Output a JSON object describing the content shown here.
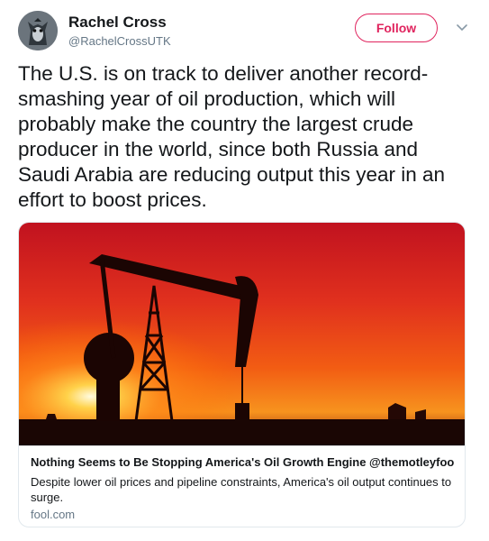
{
  "author": {
    "name": "Rachel Cross",
    "handle": "@RachelCrossUTK"
  },
  "actions": {
    "follow_label": "Follow",
    "more_icon": "chevron-down-icon"
  },
  "tweet": {
    "text": "The U.S. is on track to deliver another record-smashing year of oil production, which will probably make the country the largest crude producer in the world, since both Russia and Saudi Arabia are reducing output this year in an effort to boost prices."
  },
  "card": {
    "title": "Nothing Seems to Be Stopping America's Oil Growth Engine @themotleyfool ...",
    "description": "Despite lower oil prices and pipeline constraints, America's oil output continues to surge.",
    "domain": "fool.com"
  },
  "colors": {
    "follow_accent": "#e0245e",
    "text_primary": "#14171a",
    "text_secondary": "#657786",
    "border": "#e1e8ed"
  }
}
